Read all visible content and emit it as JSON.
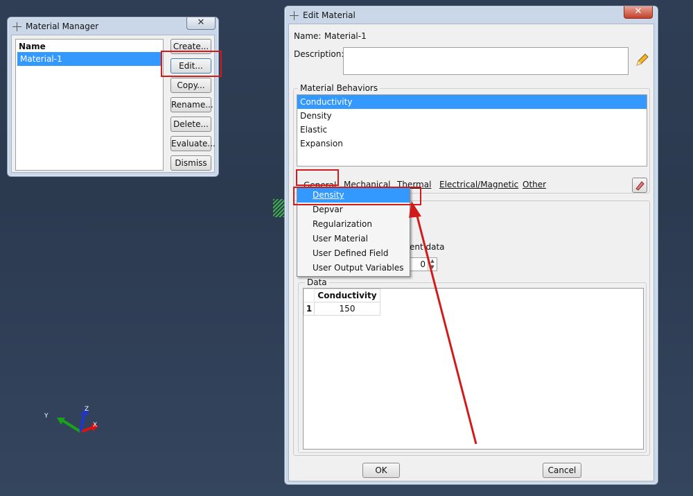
{
  "manager": {
    "title": "Material Manager",
    "close": "✕",
    "column_header": "Name",
    "items": [
      "Material-1"
    ],
    "buttons": {
      "create": "Create...",
      "edit": "Edit...",
      "copy": "Copy...",
      "rename": "Rename...",
      "delete": "Delete...",
      "evaluate": "Evaluate...",
      "dismiss": "Dismiss"
    }
  },
  "editor": {
    "title": "Edit Material",
    "close": "✕",
    "name_label": "Name:",
    "name_value": "Material-1",
    "description_label": "Description:",
    "description_value": "",
    "behaviors_label": "Material Behaviors",
    "behaviors": [
      "Conductivity",
      "Density",
      "Elastic",
      "Expansion"
    ],
    "menu": {
      "general": "General",
      "mechanical": "Mechanical",
      "thermal": "Thermal",
      "electrical": "Electrical/Magnetic",
      "other": "Other"
    },
    "dropdown": [
      "Density",
      "Depvar",
      "Regularization",
      "User Material",
      "User Defined Field",
      "User Output Variables"
    ],
    "partial_text_behind": "ent data",
    "spinner_value": "0",
    "data_label": "Data",
    "table": {
      "header": "Conductivity",
      "rows": [
        {
          "index": "1",
          "value": "150"
        }
      ]
    },
    "ok": "OK",
    "cancel": "Cancel"
  },
  "triad": {
    "x": "X",
    "y": "Y",
    "z": "Z"
  },
  "colors": {
    "accent": "#3399ff",
    "highlight_box": "#d21a1a",
    "arrow": "#d21a1a"
  }
}
